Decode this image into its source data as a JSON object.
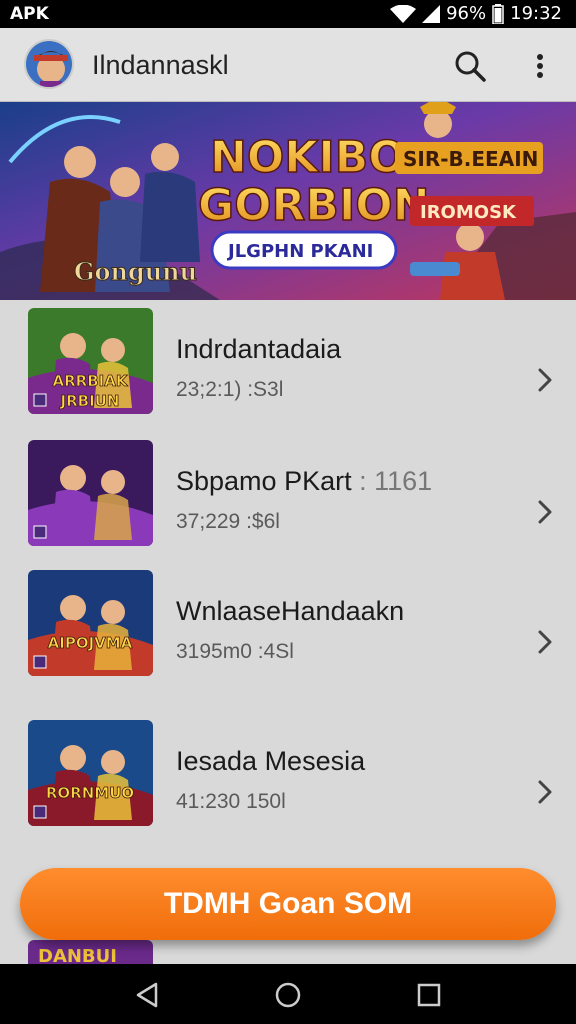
{
  "status_bar": {
    "left": "APK",
    "battery": "96%",
    "time": "19:32"
  },
  "app_bar": {
    "title": "Ilndannaskl"
  },
  "banner": {
    "headline_line1": "NOKIBO",
    "headline_line2": "GORBION",
    "tag_top": "SIR-B.EEAIN",
    "tag_mid": "IROMOSK",
    "pill": "JLGPHN PKANI",
    "corner_text": "Gongunu"
  },
  "items": [
    {
      "title": "Indrdantadaia",
      "suffix": "",
      "subtitle": "23;2:1) :S3l",
      "thumb_text": "ARRBIAK\nJRBIUN",
      "colors": [
        "#3b7a2a",
        "#7a2a8c",
        "#e9c23a"
      ]
    },
    {
      "title": "Sbpamo PKart",
      "suffix": " : 1161",
      "subtitle": "37;229 :$6l",
      "thumb_text": "",
      "colors": [
        "#3a1a5c",
        "#8a3ab8",
        "#d9a64a"
      ]
    },
    {
      "title": "WnlaaseHandaakn",
      "suffix": "",
      "subtitle": "3195m0 :4Sl",
      "thumb_text": "AIPOJVMA",
      "colors": [
        "#1a3a7a",
        "#c23a2a",
        "#e9b23a"
      ]
    },
    {
      "title": "Iesada Mesesia",
      "suffix": "",
      "subtitle": "41:230 150l",
      "thumb_text": "RORNMUO",
      "colors": [
        "#1a4a8a",
        "#8a1a2a",
        "#e9c23a"
      ]
    }
  ],
  "cta": {
    "label": "TDMH Goan SOM"
  },
  "peek_text": "DANBUI",
  "colors": {
    "accent": "#f27a12",
    "appbar": "#e2e2e2",
    "background": "#d9d9d9"
  }
}
